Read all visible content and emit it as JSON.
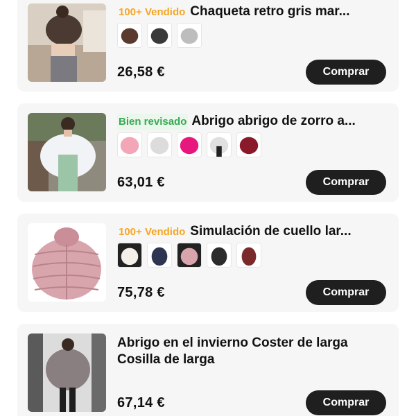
{
  "products": [
    {
      "badge": "100+ Vendido",
      "badge_color": "#f5a623",
      "title": "Chaqueta retro gris mar...",
      "price": "26,58 €",
      "buy_label": "Comprar",
      "variant_colors": [
        "#5a3a2e",
        "#3a3a3a",
        "#bdbdbd"
      ]
    },
    {
      "badge": "Bien revisado",
      "badge_color": "#3aa852",
      "title": "Abrigo abrigo de zorro a...",
      "price": "63,01 €",
      "buy_label": "Comprar",
      "variant_colors": [
        "#f2a6b8",
        "#eeeeee",
        "#e8177e",
        "#e6e6e6",
        "#8a1a2a"
      ]
    },
    {
      "badge": "100+ Vendido",
      "badge_color": "#f5a623",
      "title": "Simulación de cuello lar...",
      "price": "75,78 €",
      "buy_label": "Comprar",
      "variant_colors": [
        "#f4efe8",
        "#2d3550",
        "#d9a5ad",
        "#2b2b2b",
        "#7a2a2a"
      ]
    },
    {
      "title_line1": "Abrigo en el invierno Coster de larga",
      "title_line2": "Cosilla de larga",
      "price": "67,14 €",
      "buy_label": "Comprar"
    }
  ]
}
